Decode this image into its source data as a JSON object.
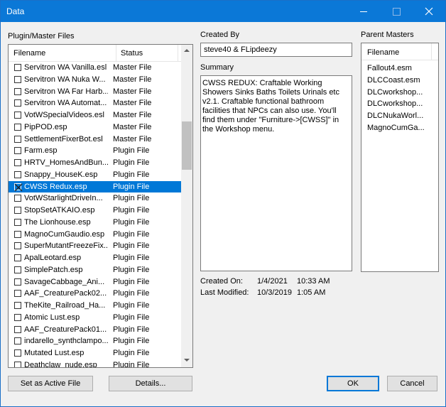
{
  "window": {
    "title": "Data"
  },
  "plugins": {
    "label": "Plugin/Master Files",
    "col_filename": "Filename",
    "col_status": "Status",
    "rows": [
      {
        "name": "Servitron WA Vanilla.esl",
        "status": "Master File"
      },
      {
        "name": "Servitron WA Nuka W...",
        "status": "Master File"
      },
      {
        "name": "Servitron WA Far Harb...",
        "status": "Master File"
      },
      {
        "name": "Servitron WA Automat...",
        "status": "Master File"
      },
      {
        "name": "VotWSpecialVideos.esl",
        "status": "Master File"
      },
      {
        "name": "PipPOD.esp",
        "status": "Master File"
      },
      {
        "name": "SettlementFixerBot.esl",
        "status": "Master File"
      },
      {
        "name": "Farm.esp",
        "status": "Plugin File"
      },
      {
        "name": "HRTV_HomesAndBun...",
        "status": "Plugin File"
      },
      {
        "name": "Snappy_HouseK.esp",
        "status": "Plugin File"
      },
      {
        "name": "CWSS Redux.esp",
        "status": "Plugin File",
        "selected": true,
        "checked": true
      },
      {
        "name": "VotWStarlightDriveIn...",
        "status": "Plugin File"
      },
      {
        "name": "StopSetATKAIO.esp",
        "status": "Plugin File"
      },
      {
        "name": "The Lionhouse.esp",
        "status": "Plugin File"
      },
      {
        "name": "MagnoCumGaudio.esp",
        "status": "Plugin File"
      },
      {
        "name": "SuperMutantFreezeFix...",
        "status": "Plugin File"
      },
      {
        "name": "ApalLeotard.esp",
        "status": "Plugin File"
      },
      {
        "name": "SimplePatch.esp",
        "status": "Plugin File"
      },
      {
        "name": "SavageCabbage_Ani...",
        "status": "Plugin File"
      },
      {
        "name": "AAF_CreaturePack02...",
        "status": "Plugin File"
      },
      {
        "name": "TheKite_Railroad_Ha...",
        "status": "Plugin File"
      },
      {
        "name": "Atomic Lust.esp",
        "status": "Plugin File"
      },
      {
        "name": "AAF_CreaturePack01...",
        "status": "Plugin File"
      },
      {
        "name": "indarello_synthclampo...",
        "status": "Plugin File"
      },
      {
        "name": "Mutated Lust.esp",
        "status": "Plugin File"
      },
      {
        "name": "Deathclaw_nude.esp",
        "status": "Plugin File"
      }
    ]
  },
  "created_by": {
    "label": "Created By",
    "value": "steve40 & FLipdeezy"
  },
  "summary": {
    "label": "Summary",
    "text": "CWSS REDUX: Craftable Working Showers Sinks Baths Toilets Urinals etc v2.1. Craftable functional bathroom facilities that NPCs can also use. You'll find them under \"Furniture->[CWSS]\" in the Workshop menu."
  },
  "parent_masters": {
    "label": "Parent Masters",
    "col_filename": "Filename",
    "items": [
      "Fallout4.esm",
      "DLCCoast.esm",
      "DLCworkshop...",
      "DLCworkshop...",
      "DLCNukaWorl...",
      "MagnoCumGa..."
    ]
  },
  "created_on": {
    "label": "Created On:",
    "date": "1/4/2021",
    "time": "10:33 AM"
  },
  "last_modified": {
    "label": "Last Modified:",
    "date": "10/3/2019",
    "time": "1:05 AM"
  },
  "buttons": {
    "set_active": "Set as Active File",
    "details": "Details...",
    "ok": "OK",
    "cancel": "Cancel"
  }
}
